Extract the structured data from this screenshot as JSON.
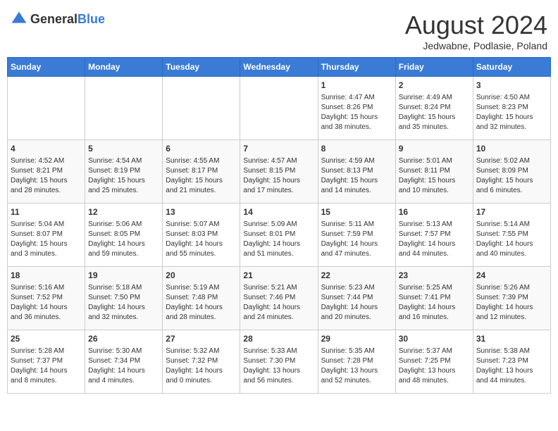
{
  "header": {
    "logo_general": "General",
    "logo_blue": "Blue",
    "title": "August 2024",
    "subtitle": "Jedwabne, Podlasie, Poland"
  },
  "days_of_week": [
    "Sunday",
    "Monday",
    "Tuesday",
    "Wednesday",
    "Thursday",
    "Friday",
    "Saturday"
  ],
  "weeks": [
    [
      {
        "day": "",
        "info": ""
      },
      {
        "day": "",
        "info": ""
      },
      {
        "day": "",
        "info": ""
      },
      {
        "day": "",
        "info": ""
      },
      {
        "day": "1",
        "info": "Sunrise: 4:47 AM\nSunset: 8:26 PM\nDaylight: 15 hours\nand 38 minutes."
      },
      {
        "day": "2",
        "info": "Sunrise: 4:49 AM\nSunset: 8:24 PM\nDaylight: 15 hours\nand 35 minutes."
      },
      {
        "day": "3",
        "info": "Sunrise: 4:50 AM\nSunset: 8:23 PM\nDaylight: 15 hours\nand 32 minutes."
      }
    ],
    [
      {
        "day": "4",
        "info": "Sunrise: 4:52 AM\nSunset: 8:21 PM\nDaylight: 15 hours\nand 28 minutes."
      },
      {
        "day": "5",
        "info": "Sunrise: 4:54 AM\nSunset: 8:19 PM\nDaylight: 15 hours\nand 25 minutes."
      },
      {
        "day": "6",
        "info": "Sunrise: 4:55 AM\nSunset: 8:17 PM\nDaylight: 15 hours\nand 21 minutes."
      },
      {
        "day": "7",
        "info": "Sunrise: 4:57 AM\nSunset: 8:15 PM\nDaylight: 15 hours\nand 17 minutes."
      },
      {
        "day": "8",
        "info": "Sunrise: 4:59 AM\nSunset: 8:13 PM\nDaylight: 15 hours\nand 14 minutes."
      },
      {
        "day": "9",
        "info": "Sunrise: 5:01 AM\nSunset: 8:11 PM\nDaylight: 15 hours\nand 10 minutes."
      },
      {
        "day": "10",
        "info": "Sunrise: 5:02 AM\nSunset: 8:09 PM\nDaylight: 15 hours\nand 6 minutes."
      }
    ],
    [
      {
        "day": "11",
        "info": "Sunrise: 5:04 AM\nSunset: 8:07 PM\nDaylight: 15 hours\nand 3 minutes."
      },
      {
        "day": "12",
        "info": "Sunrise: 5:06 AM\nSunset: 8:05 PM\nDaylight: 14 hours\nand 59 minutes."
      },
      {
        "day": "13",
        "info": "Sunrise: 5:07 AM\nSunset: 8:03 PM\nDaylight: 14 hours\nand 55 minutes."
      },
      {
        "day": "14",
        "info": "Sunrise: 5:09 AM\nSunset: 8:01 PM\nDaylight: 14 hours\nand 51 minutes."
      },
      {
        "day": "15",
        "info": "Sunrise: 5:11 AM\nSunset: 7:59 PM\nDaylight: 14 hours\nand 47 minutes."
      },
      {
        "day": "16",
        "info": "Sunrise: 5:13 AM\nSunset: 7:57 PM\nDaylight: 14 hours\nand 44 minutes."
      },
      {
        "day": "17",
        "info": "Sunrise: 5:14 AM\nSunset: 7:55 PM\nDaylight: 14 hours\nand 40 minutes."
      }
    ],
    [
      {
        "day": "18",
        "info": "Sunrise: 5:16 AM\nSunset: 7:52 PM\nDaylight: 14 hours\nand 36 minutes."
      },
      {
        "day": "19",
        "info": "Sunrise: 5:18 AM\nSunset: 7:50 PM\nDaylight: 14 hours\nand 32 minutes."
      },
      {
        "day": "20",
        "info": "Sunrise: 5:19 AM\nSunset: 7:48 PM\nDaylight: 14 hours\nand 28 minutes."
      },
      {
        "day": "21",
        "info": "Sunrise: 5:21 AM\nSunset: 7:46 PM\nDaylight: 14 hours\nand 24 minutes."
      },
      {
        "day": "22",
        "info": "Sunrise: 5:23 AM\nSunset: 7:44 PM\nDaylight: 14 hours\nand 20 minutes."
      },
      {
        "day": "23",
        "info": "Sunrise: 5:25 AM\nSunset: 7:41 PM\nDaylight: 14 hours\nand 16 minutes."
      },
      {
        "day": "24",
        "info": "Sunrise: 5:26 AM\nSunset: 7:39 PM\nDaylight: 14 hours\nand 12 minutes."
      }
    ],
    [
      {
        "day": "25",
        "info": "Sunrise: 5:28 AM\nSunset: 7:37 PM\nDaylight: 14 hours\nand 8 minutes."
      },
      {
        "day": "26",
        "info": "Sunrise: 5:30 AM\nSunset: 7:34 PM\nDaylight: 14 hours\nand 4 minutes."
      },
      {
        "day": "27",
        "info": "Sunrise: 5:32 AM\nSunset: 7:32 PM\nDaylight: 14 hours\nand 0 minutes."
      },
      {
        "day": "28",
        "info": "Sunrise: 5:33 AM\nSunset: 7:30 PM\nDaylight: 13 hours\nand 56 minutes."
      },
      {
        "day": "29",
        "info": "Sunrise: 5:35 AM\nSunset: 7:28 PM\nDaylight: 13 hours\nand 52 minutes."
      },
      {
        "day": "30",
        "info": "Sunrise: 5:37 AM\nSunset: 7:25 PM\nDaylight: 13 hours\nand 48 minutes."
      },
      {
        "day": "31",
        "info": "Sunrise: 5:38 AM\nSunset: 7:23 PM\nDaylight: 13 hours\nand 44 minutes."
      }
    ]
  ]
}
